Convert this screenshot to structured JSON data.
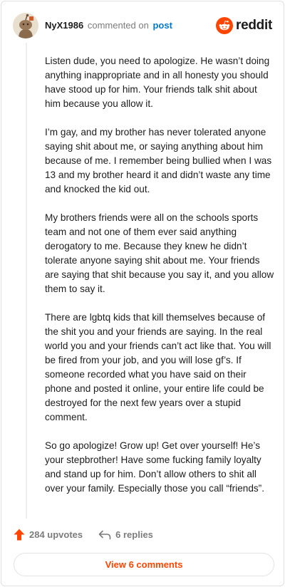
{
  "header": {
    "author": "NyX1986",
    "commented_text": "commented on",
    "post_link": "post",
    "brand": "reddit"
  },
  "comment": {
    "paragraphs": [
      "Listen dude, you need to apologize. He wasn’t doing anything inappropriate and in all honesty you should have stood up for him. Your friends talk shit about him because you allow it.",
      "I’m gay, and my brother has never tolerated anyone saying shit about me, or saying anything about him because of me. I remember being bullied when I was 13 and my brother heard it and didn’t waste any time and knocked the kid out.",
      "My brothers friends were all on the schools sports team and not one of them ever said anything derogatory to me. Because they knew he didn’t tolerate anyone saying shit about me. Your friends are saying that shit because you say it, and you allow them to say it.",
      "There are lgbtq kids that kill themselves because of the shit you and your friends are saying. In the real world you and your friends can’t act like that. You will be fired from your job, and you will lose gf’s. If someone recorded what you have said on their phone and posted it online, your entire life could be destroyed for the next few years over a stupid comment.",
      "So go apologize! Grow up! Get over yourself! He’s your stepbrother! Have some fucking family loyalty and stand up for him. Don’t allow others to shit all over your family. Especially those you call “friends”."
    ]
  },
  "actions": {
    "upvotes": "284 upvotes",
    "replies": "6 replies",
    "view_comments": "View 6 comments"
  },
  "colors": {
    "accent": "#ff4500",
    "link": "#0079d3",
    "muted": "#7c7c7c"
  },
  "icons": {
    "avatar": "snoo-avatar",
    "brand": "reddit-logo-icon",
    "upvote": "upvote-arrow-icon",
    "reply": "reply-arrow-icon"
  }
}
